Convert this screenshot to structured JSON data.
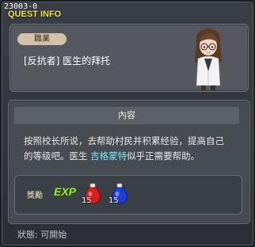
{
  "window": {
    "quest_id": "23003-0",
    "title": "QUEST INFO"
  },
  "header": {
    "job_label": "職業",
    "quest_name": "[反抗者] 医生的拜托"
  },
  "content": {
    "header": "內容",
    "line1": "按照校长所说，去帮助村民并积累经验，提高自己",
    "line2_pre": "的等级吧。医生",
    "npc_name": "吉格蒙特",
    "line2_post": "似乎正需要帮助。"
  },
  "reward": {
    "label": "獎勵",
    "exp_text": "EXP",
    "items": [
      {
        "icon": "red-potion-icon",
        "count": "15"
      },
      {
        "icon": "blue-potion-icon",
        "count": "15"
      }
    ]
  },
  "status": {
    "text": "狀態:  可開始"
  },
  "colors": {
    "title": "#f4e44a",
    "npc_highlight": "#7fe4ff",
    "exp": "#9ee63a",
    "job_badge": "#d2c3a8"
  }
}
